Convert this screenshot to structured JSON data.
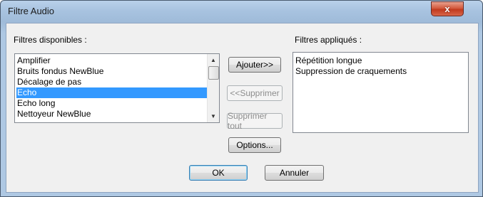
{
  "window": {
    "title": "Filtre Audio",
    "close_label": "x"
  },
  "available": {
    "label": "Filtres disponibles :",
    "items": [
      "Amplifier",
      "Bruits fondus NewBlue",
      "Décalage de pas",
      "Echo",
      "Echo long",
      "Nettoyeur NewBlue"
    ],
    "selected_index": 3
  },
  "applied": {
    "label": "Filtres appliqués :",
    "items": [
      "Répétition longue",
      "Suppression de craquements"
    ]
  },
  "buttons": {
    "add": "Ajouter>>",
    "remove": "<<Supprimer",
    "remove_all": "Supprimer tout",
    "options": "Options...",
    "ok": "OK",
    "cancel": "Annuler"
  },
  "colors": {
    "selection": "#3399ff",
    "close_button": "#c13a1e"
  },
  "icons": {
    "scroll_up": "triangle-up-icon",
    "scroll_down": "triangle-down-icon"
  }
}
